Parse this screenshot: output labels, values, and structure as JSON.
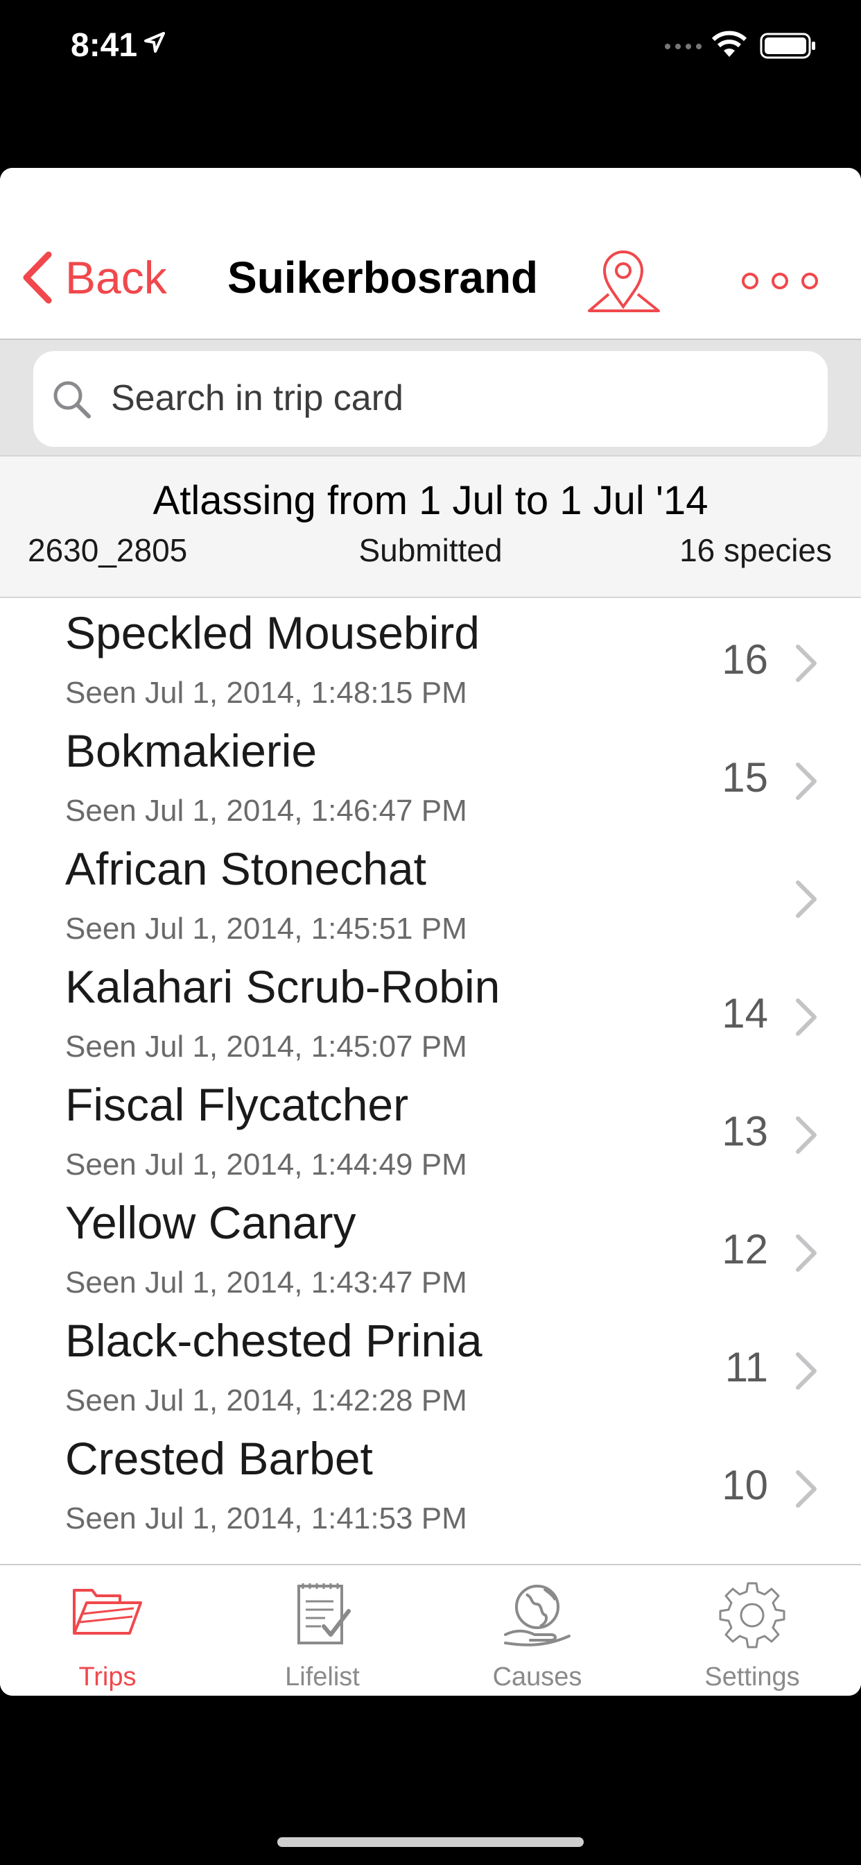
{
  "status_bar": {
    "time": "8:41"
  },
  "nav": {
    "back_label": "Back",
    "title": "Suikerbosrand"
  },
  "search": {
    "placeholder": "Search in trip card"
  },
  "trip_header": {
    "title": "Atlassing from 1 Jul to 1 Jul '14",
    "code": "2630_2805",
    "status": "Submitted",
    "species_count": "16 species"
  },
  "species": [
    {
      "name": "Speckled Mousebird",
      "seen": "Seen Jul 1, 2014, 1:48:15 PM",
      "number": "16"
    },
    {
      "name": "Bokmakierie",
      "seen": "Seen Jul 1, 2014, 1:46:47 PM",
      "number": "15"
    },
    {
      "name": "African Stonechat",
      "seen": "Seen Jul 1, 2014, 1:45:51 PM",
      "number": ""
    },
    {
      "name": "Kalahari Scrub-Robin",
      "seen": "Seen Jul 1, 2014, 1:45:07 PM",
      "number": "14"
    },
    {
      "name": "Fiscal Flycatcher",
      "seen": "Seen Jul 1, 2014, 1:44:49 PM",
      "number": "13"
    },
    {
      "name": "Yellow Canary",
      "seen": "Seen Jul 1, 2014, 1:43:47 PM",
      "number": "12"
    },
    {
      "name": "Black-chested Prinia",
      "seen": "Seen Jul 1, 2014, 1:42:28 PM",
      "number": "11"
    },
    {
      "name": "Crested Barbet",
      "seen": "Seen Jul 1, 2014, 1:41:53 PM",
      "number": "10"
    }
  ],
  "tabs": [
    {
      "label": "Trips",
      "icon": "folder-icon",
      "active": true
    },
    {
      "label": "Lifelist",
      "icon": "checklist-icon",
      "active": false
    },
    {
      "label": "Causes",
      "icon": "globe-hand-icon",
      "active": false
    },
    {
      "label": "Settings",
      "icon": "gear-icon",
      "active": false
    }
  ],
  "colors": {
    "accent": "#f0484c",
    "inactive": "#8a8a8a"
  }
}
